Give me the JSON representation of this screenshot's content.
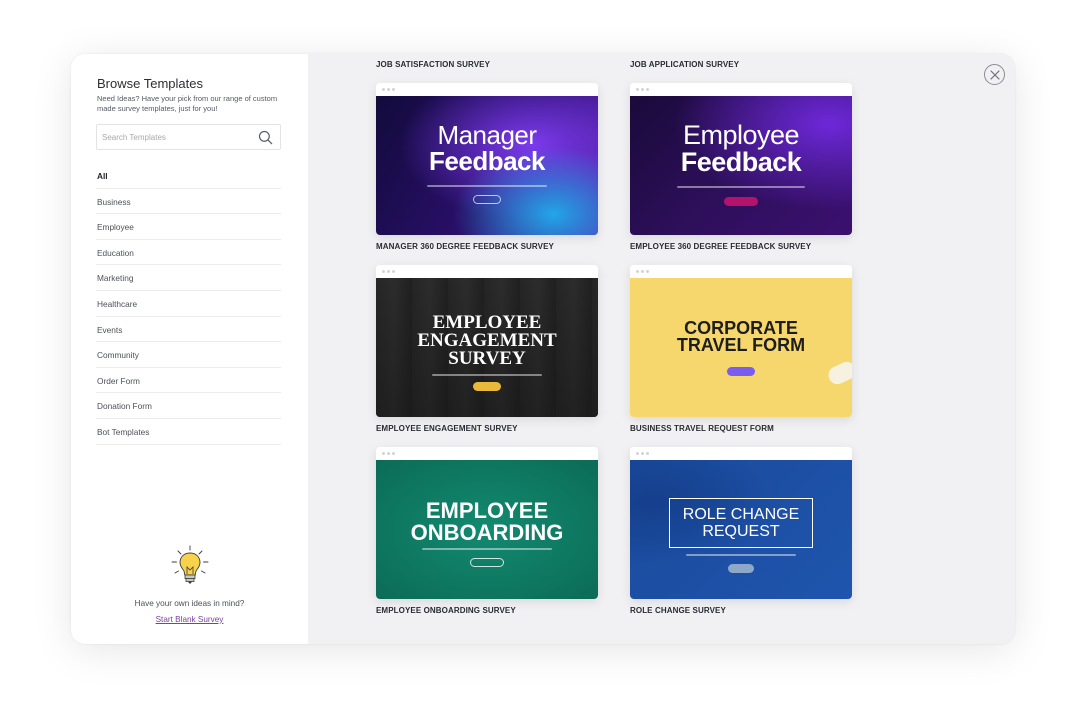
{
  "sidebar": {
    "title": "Browse Templates",
    "subtitle": "Need Ideas? Have your pick from our range of custom made survey templates, just for you!",
    "search_placeholder": "Search Templates",
    "categories": [
      "All",
      "Business",
      "Employee",
      "Education",
      "Marketing",
      "Healthcare",
      "Events",
      "Community",
      "Order Form",
      "Donation Form",
      "Bot Templates"
    ],
    "active_category": "All",
    "ideas_text": "Have your own ideas in mind?",
    "blank_link": "Start Blank Survey"
  },
  "main": {
    "top_labels": [
      "JOB SATISFACTION SURVEY",
      "JOB APPLICATION SURVEY"
    ],
    "templates": [
      {
        "label": "MANAGER 360 DEGREE FEEDBACK SURVEY",
        "headline_1": "Manager",
        "headline_2": "Feedback",
        "accent": "#7c3aed"
      },
      {
        "label": "EMPLOYEE 360 DEGREE FEEDBACK SURVEY",
        "headline_1": "Employee",
        "headline_2": "Feedback",
        "accent": "#b3136b"
      },
      {
        "label": "EMPLOYEE ENGAGEMENT SURVEY",
        "headline_1": "EMPLOYEE",
        "headline_2": "ENGAGEMENT",
        "headline_3": "SURVEY",
        "accent": "#e8b93a"
      },
      {
        "label": "BUSINESS TRAVEL REQUEST FORM",
        "headline_1": "CORPORATE",
        "headline_2": "TRAVEL FORM",
        "accent": "#7b5cf0"
      },
      {
        "label": "EMPLOYEE ONBOARDING SURVEY",
        "headline_1": "EMPLOYEE",
        "headline_2": "ONBOARDING",
        "accent": "#0f7a63"
      },
      {
        "label": "ROLE CHANGE SURVEY",
        "headline_1": "ROLE CHANGE",
        "headline_2": "REQUEST",
        "accent": "#1f4fa3"
      }
    ]
  },
  "icons": {
    "search": "search-icon",
    "close": "close-icon",
    "bulb": "lightbulb-icon"
  }
}
